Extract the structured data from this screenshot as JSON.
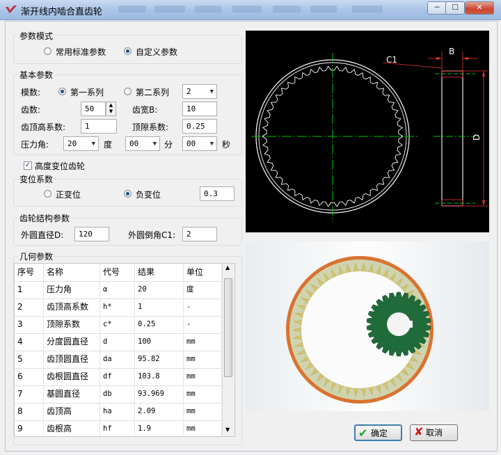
{
  "window": {
    "title": "渐开线内啮合直齿轮",
    "btn_min": "─",
    "btn_max": "☐",
    "btn_close": "✕"
  },
  "param_mode": {
    "title": "参数模式",
    "opt1": "常用标准参数",
    "opt2": "自定义参数",
    "selected": "自定义参数"
  },
  "basic": {
    "title": "基本参数",
    "module_label": "模数:",
    "series1": "第一系列",
    "series2": "第二系列",
    "module_value": "2",
    "teeth_label": "齿数:",
    "teeth_value": "50",
    "width_label": "齿宽B:",
    "width_value": "10",
    "addendum_label": "齿顶高系数:",
    "addendum_value": "1",
    "clearance_label": "顶隙系数:",
    "clearance_value": "0.25",
    "pressure_label": "压力角:",
    "deg_value": "20",
    "deg_unit": "度",
    "min_value": "00",
    "min_unit": "分",
    "sec_value": "00",
    "sec_unit": "秒"
  },
  "profile_shift": {
    "checkbox_label": "高度变位齿轮",
    "checked": true,
    "title": "变位系数",
    "pos": "正变位",
    "neg": "负变位",
    "selected": "负变位",
    "value": "0.3"
  },
  "structure": {
    "title": "齿轮结构参数",
    "outer_dia_label": "外圆直径D:",
    "outer_dia_value": "120",
    "chamfer_label": "外圆倒角C1:",
    "chamfer_value": "2"
  },
  "geometry": {
    "title": "几何参数",
    "headers": [
      "序号",
      "名称",
      "代号",
      "结果",
      "单位"
    ],
    "rows": [
      [
        "1",
        "压力角",
        "α",
        "20",
        "度"
      ],
      [
        "2",
        "齿顶高系数",
        "h*",
        "1",
        "-"
      ],
      [
        "3",
        "顶隙系数",
        "c*",
        "0.25",
        "-"
      ],
      [
        "4",
        "分度圆直径",
        "d",
        "100",
        "mm"
      ],
      [
        "5",
        "齿顶圆直径",
        "da",
        "95.82",
        "mm"
      ],
      [
        "6",
        "齿根圆直径",
        "df",
        "103.8",
        "mm"
      ],
      [
        "7",
        "基圆直径",
        "db",
        "93.969",
        "mm"
      ],
      [
        "8",
        "齿顶高",
        "ha",
        "2.09",
        "mm"
      ],
      [
        "9",
        "齿根高",
        "hf",
        "1.9",
        "mm"
      ]
    ]
  },
  "drawing": {
    "label_c1": "C1",
    "label_b": "B",
    "label_d": "D"
  },
  "buttons": {
    "ok": "确定",
    "cancel": "取消"
  }
}
